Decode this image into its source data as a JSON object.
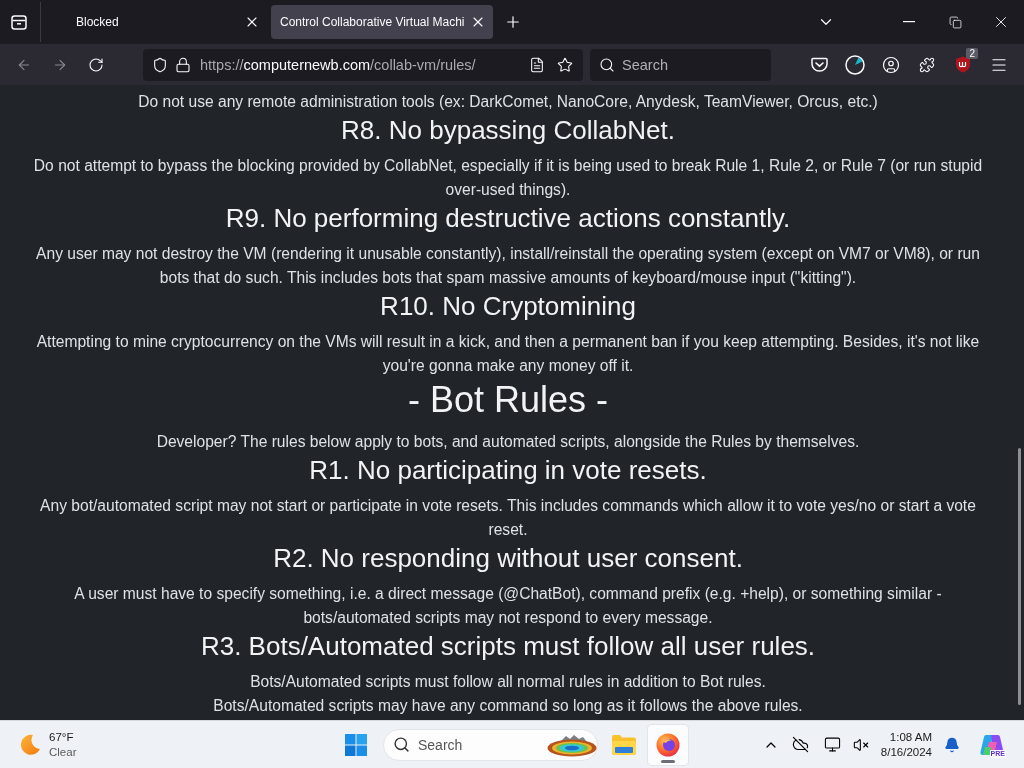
{
  "browser": {
    "tabs": [
      {
        "title": "Blocked",
        "selected": false
      },
      {
        "title": "Control Collaborative Virtual Machi",
        "selected": true
      }
    ],
    "address": {
      "scheme": "https://",
      "host": "computernewb.com",
      "path": "/collab-vm/rules/"
    },
    "search": {
      "placeholder": "Search"
    },
    "extension_badge": "2"
  },
  "page": {
    "blocks": [
      {
        "kind": "paragraph",
        "text": "Do not use any remote administration tools (ex: DarkComet, NanoCore, Anydesk, TeamViewer, Orcus, etc.)"
      },
      {
        "kind": "heading",
        "text": "R8. No bypassing CollabNet."
      },
      {
        "kind": "paragraph",
        "text": "Do not attempt to bypass the blocking provided by CollabNet, especially if it is being used to break Rule 1, Rule 2, or Rule 7 (or run stupid over-used things)."
      },
      {
        "kind": "heading",
        "text": "R9. No performing destructive actions constantly."
      },
      {
        "kind": "paragraph",
        "text": "Any user may not destroy the VM (rendering it unusable constantly), install/reinstall the operating system (except on VM7 or VM8), or run bots that do such. This includes bots that spam massive amounts of keyboard/mouse input (\"kitting\")."
      },
      {
        "kind": "heading",
        "text": "R10. No Cryptomining"
      },
      {
        "kind": "paragraph",
        "text": "Attempting to mine cryptocurrency on the VMs will result in a kick, and then a permanent ban if you keep attempting. Besides, it's not like you're gonna make any money off it."
      },
      {
        "kind": "section",
        "text": "- Bot Rules -"
      },
      {
        "kind": "paragraph",
        "text": "Developer? The rules below apply to bots, and automated scripts, alongside the Rules by themselves."
      },
      {
        "kind": "heading",
        "text": "R1. No participating in vote resets."
      },
      {
        "kind": "paragraph",
        "text": "Any bot/automated script may not start or participate in vote resets. This includes commands which allow it to vote yes/no or start a vote reset."
      },
      {
        "kind": "heading",
        "text": "R2. No responding without user consent."
      },
      {
        "kind": "paragraph",
        "text": "A user must have to specify something, i.e. a direct message (@ChatBot), command prefix (e.g. +help), or something similar - bots/automated scripts may not respond to every message."
      },
      {
        "kind": "heading",
        "text": "R3. Bots/Automated scripts must follow all user rules."
      },
      {
        "kind": "paragraph",
        "text": "Bots/Automated scripts must follow all normal rules in addition to Bot rules."
      },
      {
        "kind": "paragraph",
        "text": "Bots/Automated scripts may have any command so long as it follows the above rules."
      }
    ]
  },
  "taskbar": {
    "weather": {
      "temperature": "67°F",
      "condition": "Clear"
    },
    "search": {
      "placeholder": "Search"
    },
    "apps": [
      {
        "kind": "folder",
        "selected": false
      },
      {
        "kind": "browser",
        "selected": true
      }
    ],
    "clock": {
      "time": "1:08 AM",
      "date": "8/16/2024"
    },
    "copilot_badge": "PRE"
  }
}
